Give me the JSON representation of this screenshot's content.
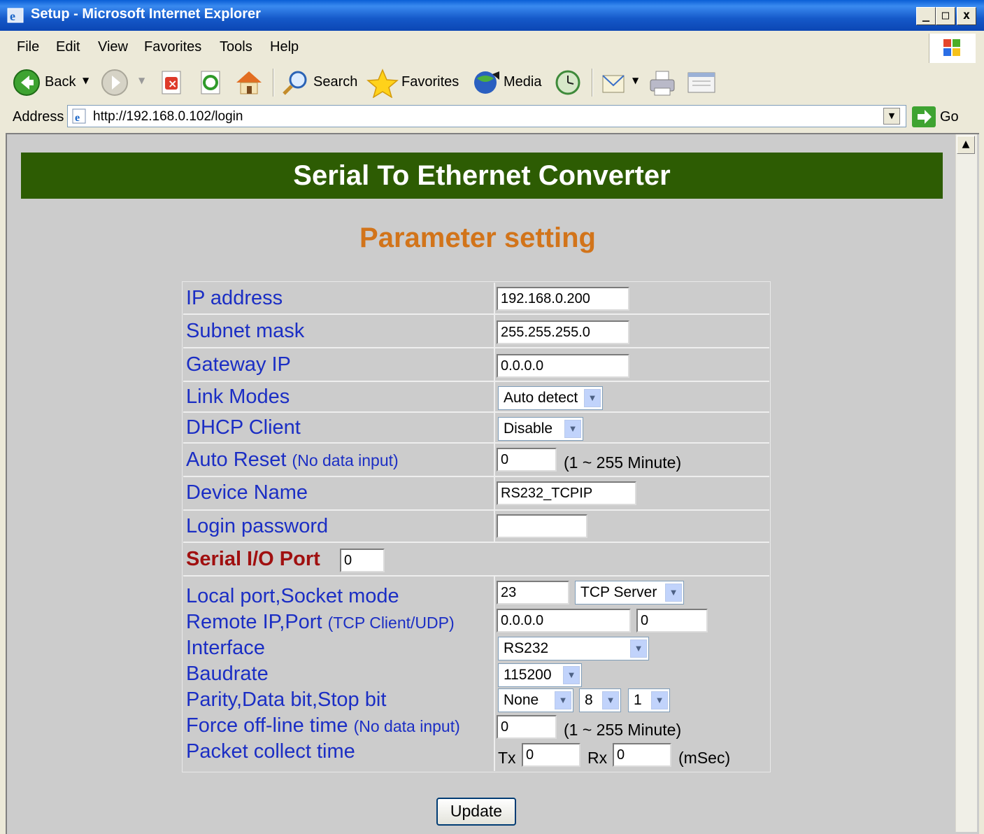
{
  "window": {
    "title": "Setup - Microsoft Internet Explorer",
    "minimize": "_",
    "maximize": "□",
    "close": "x"
  },
  "menu": [
    "File",
    "Edit",
    "View",
    "Favorites",
    "Tools",
    "Help"
  ],
  "toolbar": {
    "back": "Back",
    "search": "Search",
    "favorites": "Favorites",
    "media": "Media"
  },
  "address": {
    "label": "Address",
    "url": "http://192.168.0.102/login",
    "go": "Go"
  },
  "page": {
    "banner": "Serial To Ethernet Converter",
    "subtitle": "Parameter setting",
    "labels": {
      "ip": "IP address",
      "subnet": "Subnet mask",
      "gateway": "Gateway IP",
      "link": "Link Modes",
      "dhcp": "DHCP Client",
      "autoreset": "Auto Reset",
      "autoreset_note": "(No data input)",
      "devname": "Device Name",
      "password": "Login password",
      "serialport": "Serial I/O Port",
      "localport": "Local port,Socket mode",
      "remote": "Remote IP,Port",
      "remote_note": "(TCP Client/UDP)",
      "interface": "Interface",
      "baud": "Baudrate",
      "parity": "Parity,Data bit,Stop bit",
      "forceoff": "Force off-line time",
      "forceoff_note": "(No data input)",
      "packet": "Packet collect time"
    },
    "values": {
      "ip": "192.168.0.200",
      "subnet": "255.255.255.0",
      "gateway": "0.0.0.0",
      "link": "Auto detect",
      "dhcp": "Disable",
      "autoreset": "0",
      "autoreset_range": "(1 ~ 255 Minute)",
      "devname": "RS232_TCPIP",
      "password": "",
      "serialport": "0",
      "localport": "23",
      "socketmode": "TCP Server",
      "remote_ip": "0.0.0.0",
      "remote_port": "0",
      "interface": "RS232",
      "baud": "115200",
      "parity": "None",
      "databit": "8",
      "stopbit": "1",
      "forceoff": "0",
      "forceoff_range": "(1 ~ 255 Minute)",
      "tx_label": "Tx",
      "tx": "0",
      "rx_label": "Rx",
      "rx": "0",
      "packet_unit": "(mSec)"
    },
    "update": "Update"
  },
  "colors": {
    "banner": "#2d5c03",
    "subtitle": "#d2741a",
    "label": "#1b2ec4",
    "serial_label": "#a01010",
    "content_bg": "#cccccc"
  }
}
